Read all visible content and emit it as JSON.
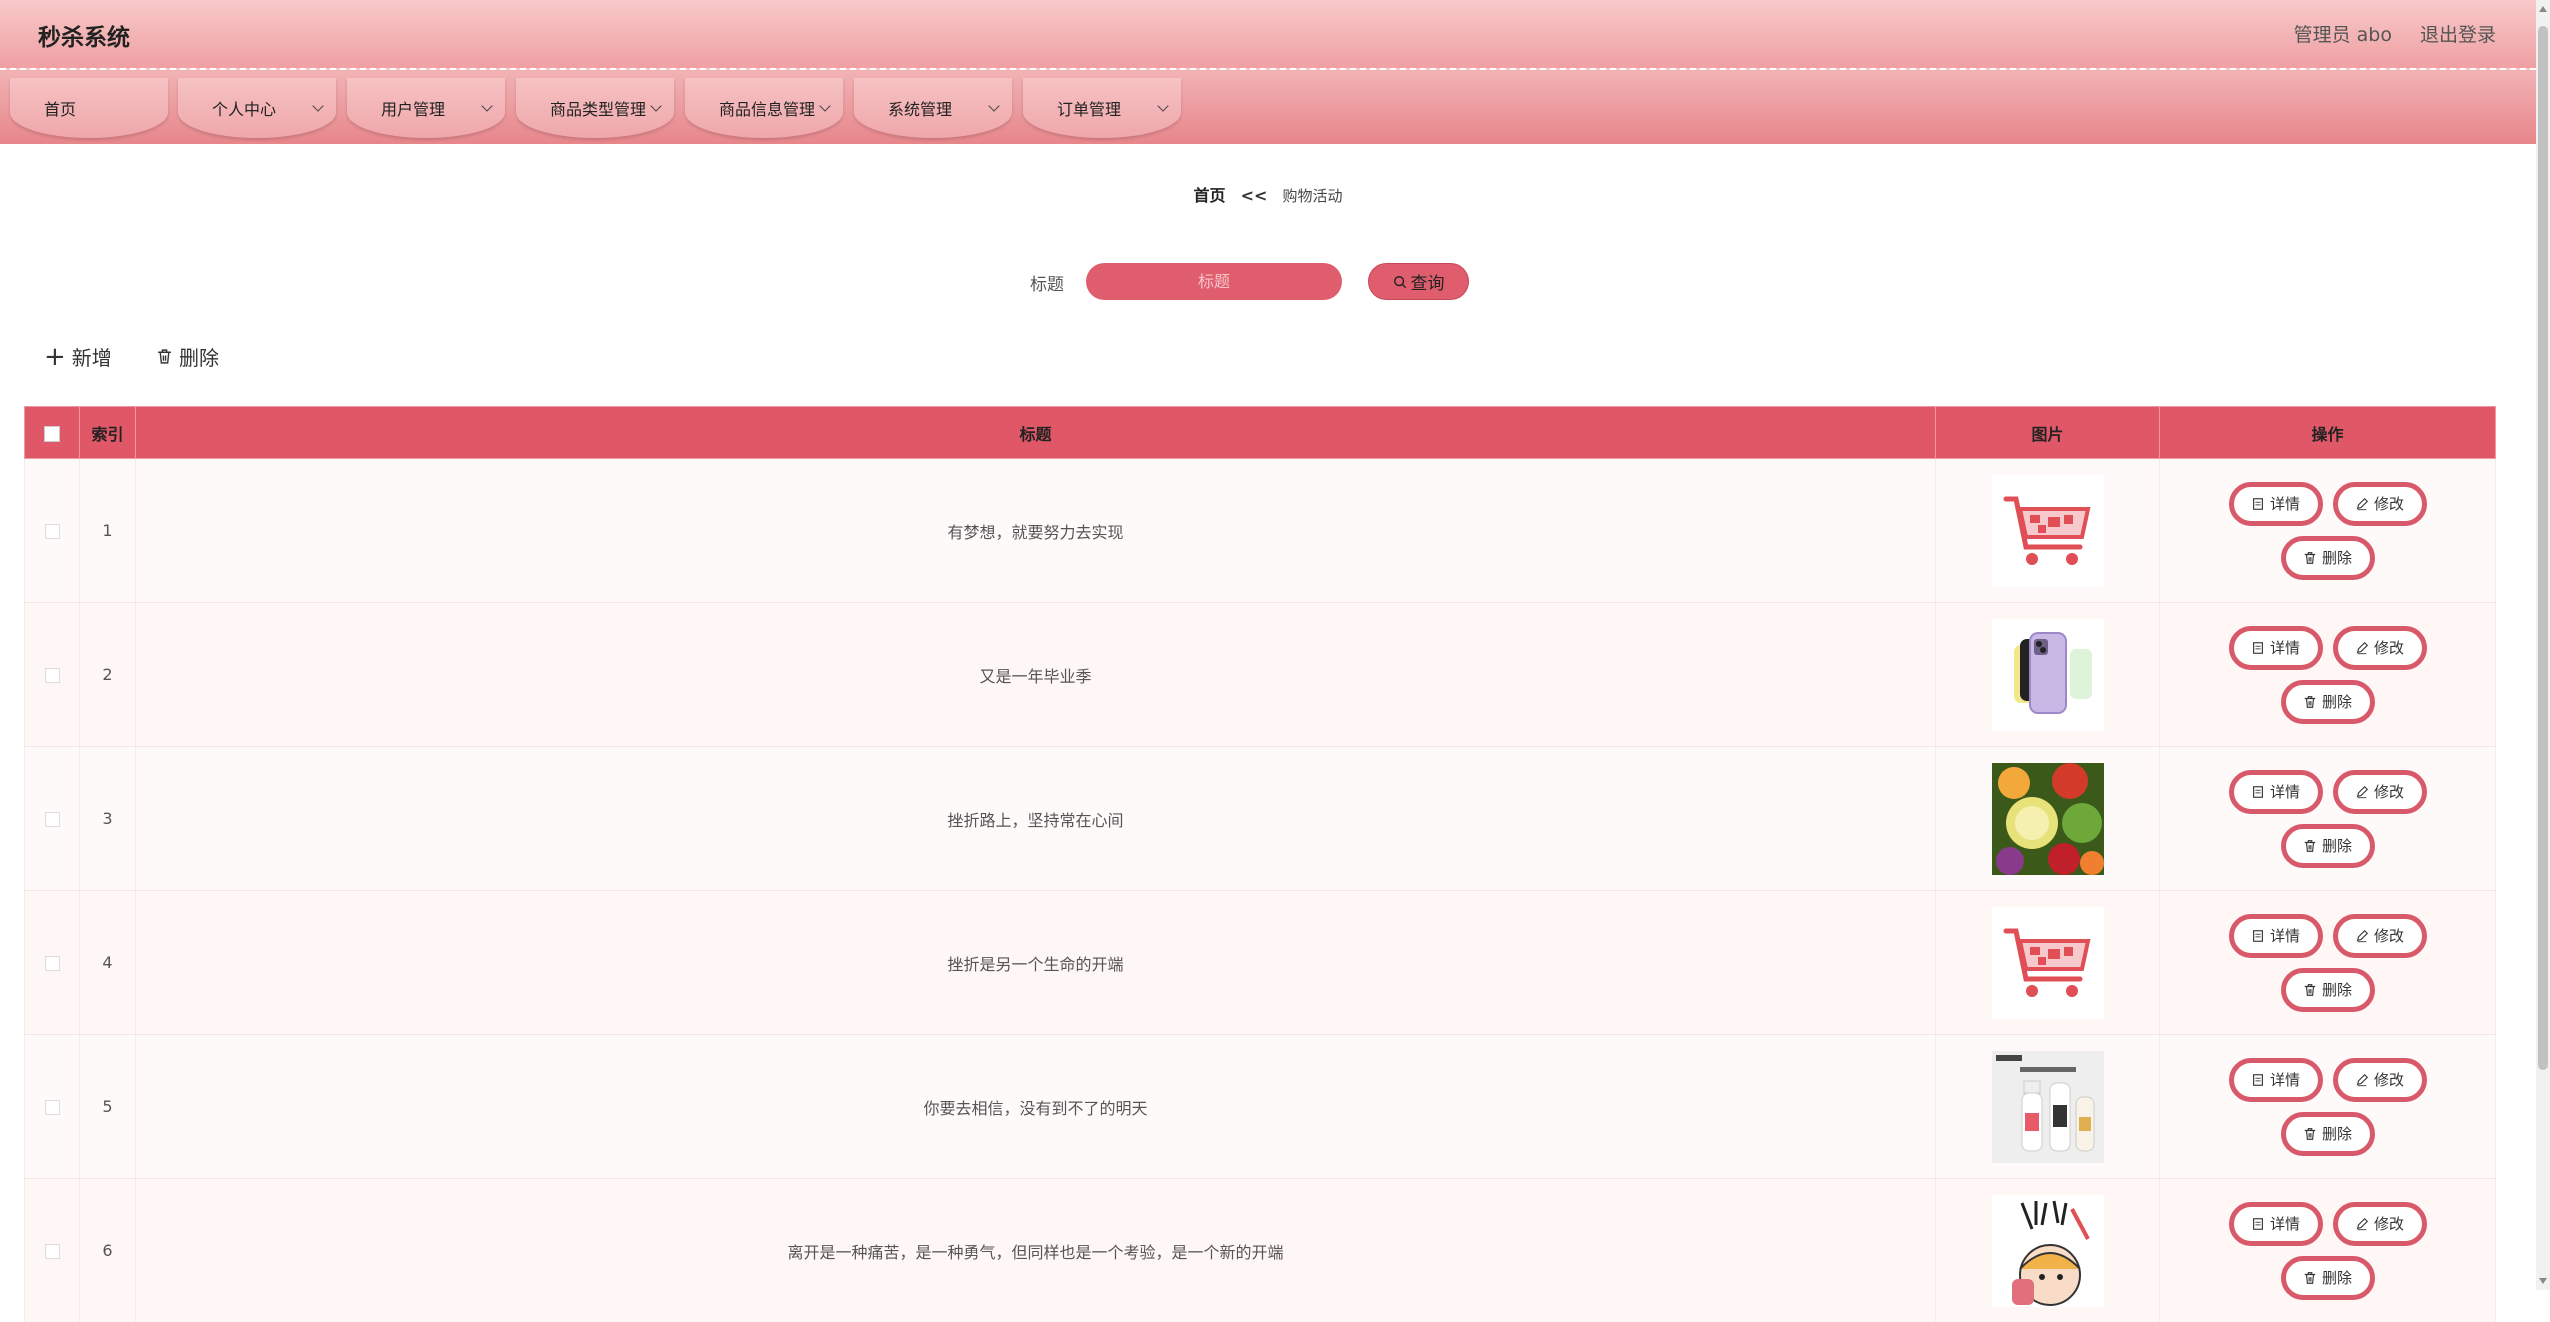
{
  "header": {
    "title": "秒杀系统",
    "user_label": "管理员 abo",
    "logout_label": "退出登录"
  },
  "nav": [
    {
      "label": "首页",
      "has_dropdown": false
    },
    {
      "label": "个人中心",
      "has_dropdown": true
    },
    {
      "label": "用户管理",
      "has_dropdown": true
    },
    {
      "label": "商品类型管理",
      "has_dropdown": true
    },
    {
      "label": "商品信息管理",
      "has_dropdown": true
    },
    {
      "label": "系统管理",
      "has_dropdown": true
    },
    {
      "label": "订单管理",
      "has_dropdown": true
    }
  ],
  "breadcrumb": {
    "home": "首页",
    "separator": "<<",
    "current": "购物活动"
  },
  "search": {
    "label": "标题",
    "placeholder": "标题",
    "value": "",
    "button_label": "查询"
  },
  "toolbar": {
    "add_label": "新增",
    "delete_label": "删除"
  },
  "table": {
    "headers": {
      "index": "索引",
      "title": "标题",
      "image": "图片",
      "actions": "操作"
    },
    "rows": [
      {
        "index": "1",
        "title": "有梦想，就要努力去实现",
        "image_icon": "shopping-cart-image"
      },
      {
        "index": "2",
        "title": "又是一年毕业季",
        "image_icon": "smartphone-image"
      },
      {
        "index": "3",
        "title": "挫折路上，坚持常在心间",
        "image_icon": "fruits-image"
      },
      {
        "index": "4",
        "title": "挫折是另一个生命的开端",
        "image_icon": "shopping-cart-image"
      },
      {
        "index": "5",
        "title": "你要去相信，没有到不了的明天",
        "image_icon": "drink-bottles-image"
      },
      {
        "index": "6",
        "title": "离开是一种痛苦，是一种勇气，但同样也是一个考验，是一个新的开端",
        "image_icon": "cartoon-girl-image"
      }
    ],
    "row_actions": {
      "detail": "详情",
      "edit": "修改",
      "delete": "删除"
    }
  },
  "colors": {
    "accent": "#e05867",
    "header_bg": "#f3b2b4",
    "button_border": "#d85a6a"
  }
}
